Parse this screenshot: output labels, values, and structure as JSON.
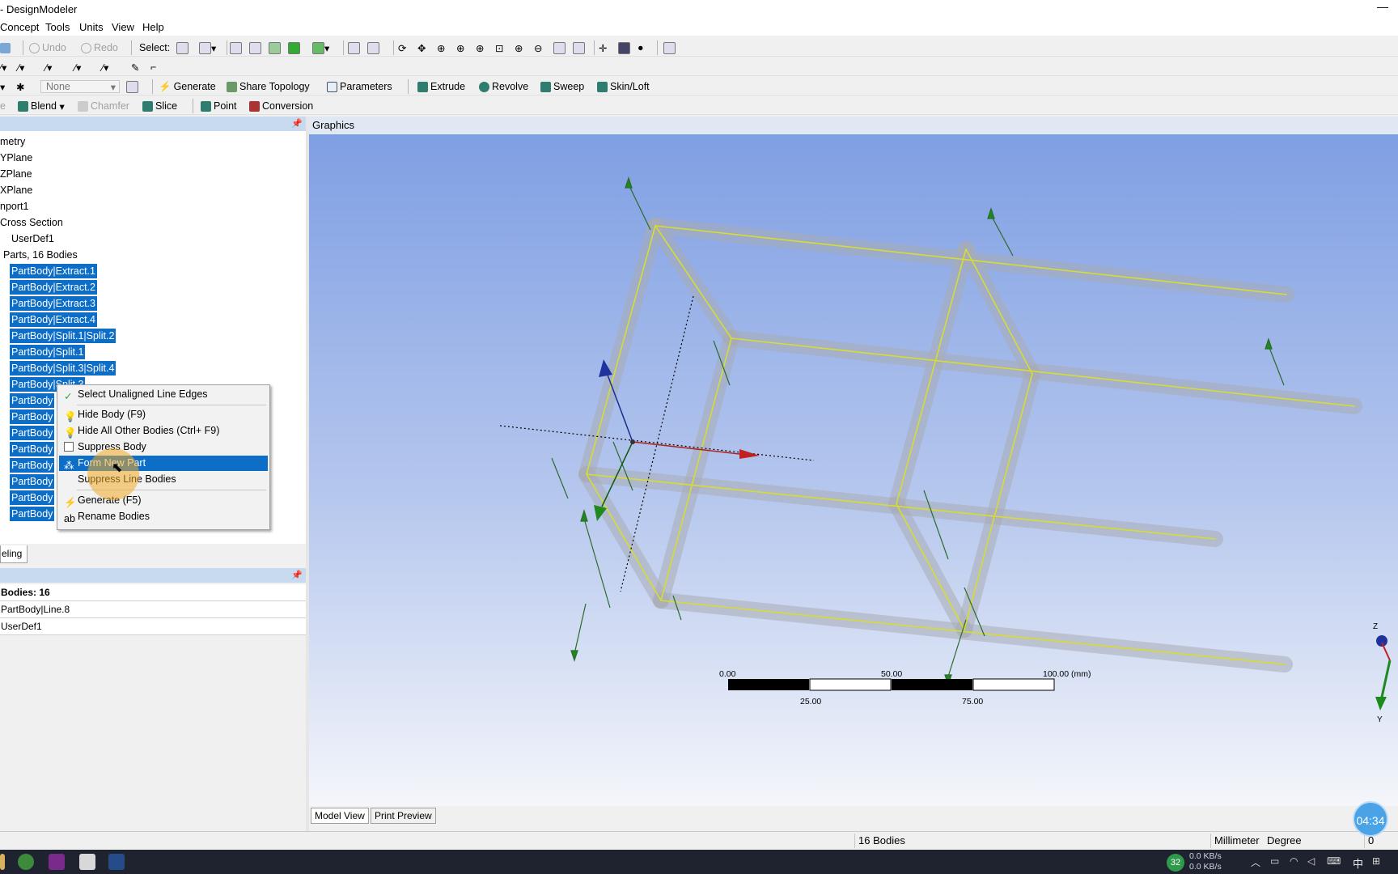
{
  "window": {
    "title": "- DesignModeler",
    "minimize_glyph": "—"
  },
  "menu": [
    "Concept",
    "Tools",
    "Units",
    "View",
    "Help"
  ],
  "toolbar1": {
    "undo": "Undo",
    "redo": "Redo",
    "select": "Select:"
  },
  "toolbar3": {
    "plane_value": "None",
    "generate": "Generate",
    "share_topology": "Share Topology",
    "parameters": "Parameters",
    "extrude": "Extrude",
    "revolve": "Revolve",
    "sweep": "Sweep",
    "skin_loft": "Skin/Loft"
  },
  "toolbar4": {
    "partial": "e",
    "blend": "Blend",
    "chamfer": "Chamfer",
    "slice": "Slice",
    "point": "Point",
    "conversion": "Conversion"
  },
  "tree": {
    "items": [
      "metry",
      "YPlane",
      "ZPlane",
      "XPlane",
      "nport1",
      "Cross Section",
      "UserDef1",
      "Parts, 16 Bodies",
      "PartBody|Extract.1",
      "PartBody|Extract.2",
      "PartBody|Extract.3",
      "PartBody|Extract.4",
      "PartBody|Split.1|Split.2",
      "PartBody|Split.1",
      "PartBody|Split.3|Split.4",
      "PartBody|Split.3",
      "PartBody",
      "PartBody",
      "PartBody",
      "PartBody",
      "PartBody",
      "PartBody",
      "PartBody",
      "PartBody"
    ]
  },
  "context_menu": {
    "items": [
      {
        "label": "Select Unaligned Line Edges",
        "icon": "check-edge-icon"
      },
      {
        "label": "Hide Body (F9)",
        "icon": "bulb-icon"
      },
      {
        "label": "Hide All Other Bodies (Ctrl+ F9)",
        "icon": "bulb-icon"
      },
      {
        "label": "Suppress Body",
        "icon": "suppress-icon"
      },
      {
        "label": "Form New Part",
        "icon": "form-part-icon"
      },
      {
        "label": "Suppress Line Bodies",
        "icon": ""
      },
      {
        "label": "Generate (F5)",
        "icon": "lightning-icon"
      },
      {
        "label": "Rename Bodies",
        "icon": "rename-icon"
      }
    ]
  },
  "tabs": {
    "modeling": "eling"
  },
  "details": {
    "rows": [
      "Bodies: 16",
      "PartBody|Line.8",
      "UserDef1"
    ]
  },
  "graphics": {
    "header": "Graphics"
  },
  "scale": {
    "labels_top": [
      "0.00",
      "50.00",
      "100.00 (mm)"
    ],
    "labels_bottom": [
      "25.00",
      "75.00"
    ]
  },
  "triad": {
    "z": "Z",
    "y": "Y"
  },
  "view_tabs": {
    "model_view": "Model View",
    "print_preview": "Print Preview"
  },
  "status": {
    "bodies": "16 Bodies",
    "unit_length": "Millimeter",
    "unit_angle": "Degree",
    "value": "0"
  },
  "timer": "04:34",
  "taskbar": {
    "badge": "32",
    "net_up": "0.0 KB/s",
    "net_down": "0.0 KB/s",
    "ime": "中"
  },
  "colors": {
    "selection": "#0d6ec8",
    "viewport_top": "#7f9fe3",
    "viewport_bottom": "#f4f6fa",
    "beam_center": "#d8dc30"
  }
}
